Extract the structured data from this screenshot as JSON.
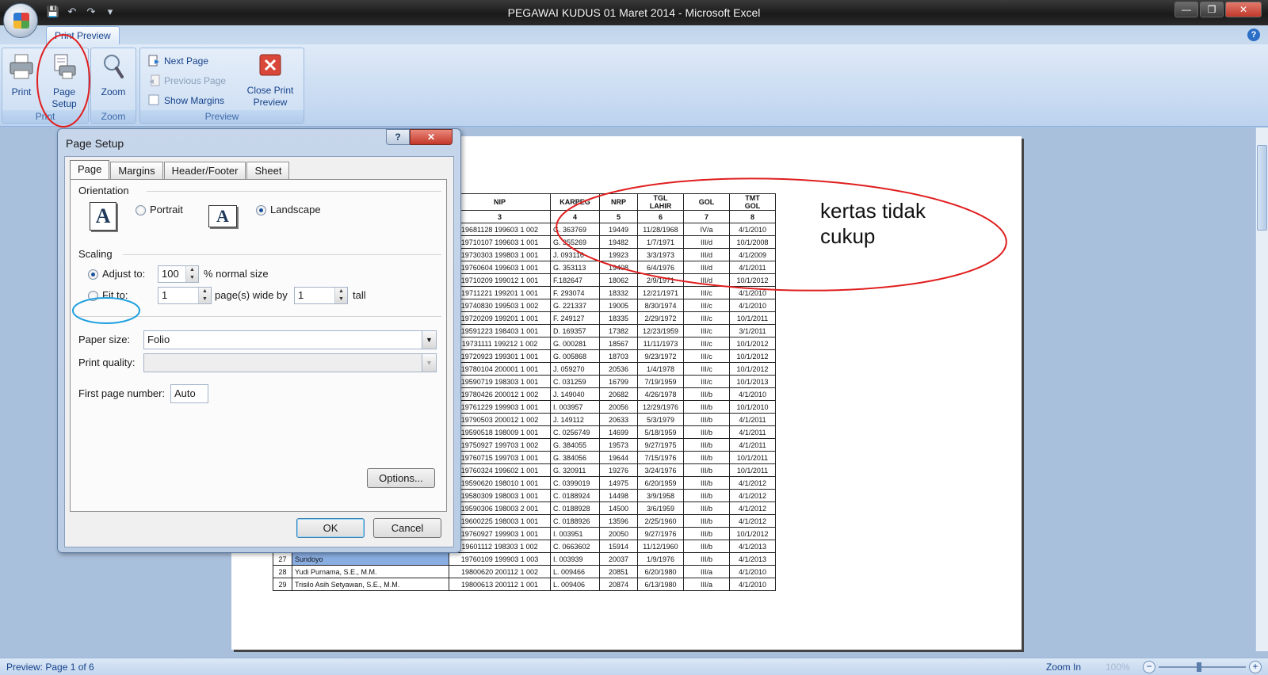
{
  "window": {
    "title": "PEGAWAI KUDUS 01 Maret 2014  -  Microsoft Excel"
  },
  "ribbon": {
    "tab": "Print Preview",
    "print_group": {
      "label": "Print",
      "print": "Print",
      "page_setup": "Page Setup"
    },
    "zoom_group": {
      "label": "Zoom",
      "zoom": "Zoom"
    },
    "preview_group": {
      "label": "Preview",
      "next_page": "Next Page",
      "previous_page": "Previous Page",
      "show_margins": "Show Margins",
      "close_print_preview": "Close Print Preview"
    }
  },
  "dialog": {
    "title": "Page Setup",
    "tabs": [
      "Page",
      "Margins",
      "Header/Footer",
      "Sheet"
    ],
    "active_tab": "Page",
    "orientation": {
      "label": "Orientation",
      "portrait": "Portrait",
      "landscape": "Landscape",
      "selected": "Landscape"
    },
    "scaling": {
      "label": "Scaling",
      "adjust_to_label": "Adjust to:",
      "adjust_value": "100",
      "adjust_suffix": "% normal size",
      "fit_to_label": "Fit to:",
      "fit_wide": "1",
      "wide_by_label": "page(s) wide by",
      "fit_tall": "1",
      "tall_label": "tall",
      "selected": "Adjust to"
    },
    "paper_size": {
      "label": "Paper size:",
      "value": "Folio"
    },
    "print_quality": {
      "label": "Print quality:",
      "value": ""
    },
    "first_page_number": {
      "label": "First page number:",
      "value": "Auto"
    },
    "options_button": "Options...",
    "ok_button": "OK",
    "cancel_button": "Cancel"
  },
  "sheet": {
    "headers": {
      "nip": "NIP",
      "karpeg": "KARPEG",
      "nrp": "NRP",
      "tgl": "TGL",
      "lahir": "LAHIR",
      "gol": "GOL",
      "tmt": "TMT",
      "tmt2": "GOL"
    },
    "col_numbers": [
      "3",
      "4",
      "5",
      "6",
      "7",
      "8"
    ],
    "rows": [
      {
        "no": "",
        "name": "",
        "nip": "19681128 199603 1 002",
        "karpeg": "G. 363769",
        "nrp": "19449",
        "tgl": "11/28/1968",
        "gol": "IV/a",
        "tmt": "4/1/2010"
      },
      {
        "no": "",
        "name": "",
        "nip": "19710107 199603 1 001",
        "karpeg": "G. 355269",
        "nrp": "19482",
        "tgl": "1/7/1971",
        "gol": "III/d",
        "tmt": "10/1/2008"
      },
      {
        "no": "",
        "name": "",
        "nip": "19730303 199803 1 001",
        "karpeg": "J. 093116",
        "nrp": "19923",
        "tgl": "3/3/1973",
        "gol": "III/d",
        "tmt": "4/1/2009"
      },
      {
        "no": "",
        "name": "",
        "nip": "19760604 199603 1 001",
        "karpeg": "G. 353113",
        "nrp": "19408",
        "tgl": "6/4/1976",
        "gol": "III/d",
        "tmt": "4/1/2011"
      },
      {
        "no": "",
        "name": "",
        "nip": "19710209 199012 1 001",
        "karpeg": "F.182647",
        "nrp": "18062",
        "tgl": "2/9/1971",
        "gol": "III/d",
        "tmt": "10/1/2012"
      },
      {
        "no": "",
        "name": "",
        "nip": "19711221 199201 1 001",
        "karpeg": "F. 293074",
        "nrp": "18332",
        "tgl": "12/21/1971",
        "gol": "III/c",
        "tmt": "4/1/2010"
      },
      {
        "no": "",
        "name": "",
        "nip": "19740830 199503 1 002",
        "karpeg": "G. 221337",
        "nrp": "19005",
        "tgl": "8/30/1974",
        "gol": "III/c",
        "tmt": "4/1/2010"
      },
      {
        "no": "",
        "name": "",
        "nip": "19720209 199201 1 001",
        "karpeg": "F. 249127",
        "nrp": "18335",
        "tgl": "2/29/1972",
        "gol": "III/c",
        "tmt": "10/1/2011"
      },
      {
        "no": "",
        "name": "",
        "nip": "19591223 198403 1 001",
        "karpeg": "D. 169357",
        "nrp": "17382",
        "tgl": "12/23/1959",
        "gol": "III/c",
        "tmt": "3/1/2011"
      },
      {
        "no": "",
        "name": "",
        "nip": "19731111 199212 1 002",
        "karpeg": "G. 000281",
        "nrp": "18567",
        "tgl": "11/11/1973",
        "gol": "III/c",
        "tmt": "10/1/2012"
      },
      {
        "no": "",
        "name": "",
        "nip": "19720923 199301 1 001",
        "karpeg": "G. 005868",
        "nrp": "18703",
        "tgl": "9/23/1972",
        "gol": "III/c",
        "tmt": "10/1/2012"
      },
      {
        "no": "",
        "name": "",
        "nip": "19780104 200001 1 001",
        "karpeg": "J. 059270",
        "nrp": "20536",
        "tgl": "1/4/1978",
        "gol": "III/c",
        "tmt": "10/1/2012"
      },
      {
        "no": "",
        "name": "",
        "nip": "19590719 198303 1 001",
        "karpeg": "C. 031259",
        "nrp": "16799",
        "tgl": "7/19/1959",
        "gol": "III/c",
        "tmt": "10/1/2013"
      },
      {
        "no": "",
        "name": "",
        "nip": "19780426 200012 1 002",
        "karpeg": "J. 149040",
        "nrp": "20682",
        "tgl": "4/26/1978",
        "gol": "III/b",
        "tmt": "4/1/2010"
      },
      {
        "no": "",
        "name": "",
        "nip": "19761229 199903 1 001",
        "karpeg": "I. 003957",
        "nrp": "20056",
        "tgl": "12/29/1976",
        "gol": "III/b",
        "tmt": "10/1/2010"
      },
      {
        "no": "",
        "name": "",
        "nip": "19790503 200012 1 002",
        "karpeg": "J. 149112",
        "nrp": "20633",
        "tgl": "5/3/1979",
        "gol": "III/b",
        "tmt": "4/1/2011"
      },
      {
        "no": "",
        "name": "",
        "nip": "19590518 198009 1 001",
        "karpeg": "C. 0256749",
        "nrp": "14699",
        "tgl": "5/18/1959",
        "gol": "III/b",
        "tmt": "4/1/2011"
      },
      {
        "no": "",
        "name": "",
        "nip": "19750927 199703 1 002",
        "karpeg": "G. 384055",
        "nrp": "19573",
        "tgl": "9/27/1975",
        "gol": "III/b",
        "tmt": "4/1/2011"
      },
      {
        "no": "",
        "name": "",
        "nip": "19760715 199703 1 001",
        "karpeg": "G. 384056",
        "nrp": "19644",
        "tgl": "7/15/1976",
        "gol": "III/b",
        "tmt": "10/1/2011"
      },
      {
        "no": "",
        "name": "",
        "nip": "19760324 199602 1 001",
        "karpeg": "G. 320911",
        "nrp": "19276",
        "tgl": "3/24/1976",
        "gol": "III/b",
        "tmt": "10/1/2011"
      },
      {
        "no": "",
        "name": "",
        "nip": "19590620 198010 1 001",
        "karpeg": "C. 0399019",
        "nrp": "14975",
        "tgl": "6/20/1959",
        "gol": "III/b",
        "tmt": "4/1/2012"
      },
      {
        "no": "",
        "name": "",
        "nip": "19580309 198003 1 001",
        "karpeg": "C. 0188924",
        "nrp": "14498",
        "tgl": "3/9/1958",
        "gol": "III/b",
        "tmt": "4/1/2012"
      },
      {
        "no": "",
        "name": "",
        "nip": "19590306 198003 2 001",
        "karpeg": "C. 0188928",
        "nrp": "14500",
        "tgl": "3/6/1959",
        "gol": "III/b",
        "tmt": "4/1/2012"
      },
      {
        "no": "",
        "name": "",
        "nip": "19600225 198003 1 001",
        "karpeg": "C. 0188926",
        "nrp": "13596",
        "tgl": "2/25/1960",
        "gol": "III/b",
        "tmt": "4/1/2012"
      },
      {
        "no": "",
        "name": "",
        "nip": "19760927 199903 1 001",
        "karpeg": "I. 003951",
        "nrp": "20050",
        "tgl": "9/27/1976",
        "gol": "III/b",
        "tmt": "10/1/2012"
      },
      {
        "no": "26",
        "name": "Trisno Yuwono Santosa, S.H.",
        "nip": "19601112 198303 1 002",
        "karpeg": "C. 0663602",
        "nrp": "15914",
        "tgl": "11/12/1960",
        "gol": "III/b",
        "tmt": "4/1/2013"
      },
      {
        "no": "27",
        "name": "Sundoyo",
        "nip": "19760109 199903 1 003",
        "karpeg": "I. 003939",
        "nrp": "20037",
        "tgl": "1/9/1976",
        "gol": "III/b",
        "tmt": "4/1/2013"
      },
      {
        "no": "28",
        "name": "Yudi Purnama, S.E., M.M.",
        "nip": "19800620 200112 1 002",
        "karpeg": "L. 009466",
        "nrp": "20851",
        "tgl": "6/20/1980",
        "gol": "III/a",
        "tmt": "4/1/2010"
      },
      {
        "no": "29",
        "name": "Trisilo Asih Setyawan, S.E., M.M.",
        "nip": "19800613 200112 1 001",
        "karpeg": "L. 009406",
        "nrp": "20874",
        "tgl": "6/13/1980",
        "gol": "III/a",
        "tmt": "4/1/2010"
      }
    ]
  },
  "annotation": {
    "line1": "kertas tidak",
    "line2": "cukup"
  },
  "status": {
    "text": "Preview: Page 1 of 6",
    "zoom_in": "Zoom In",
    "zoom_pct": "100%"
  },
  "colors": {
    "annotation_red": "#e01e1e",
    "annotation_blue": "#1ea0e0",
    "ribbon": "#c7daf1"
  },
  "icons": [
    "save-icon",
    "undo-icon",
    "redo-icon",
    "printer-icon",
    "page-setup-icon",
    "zoom-icon",
    "next-page-icon",
    "previous-page-icon",
    "close-preview-icon",
    "help-icon"
  ]
}
